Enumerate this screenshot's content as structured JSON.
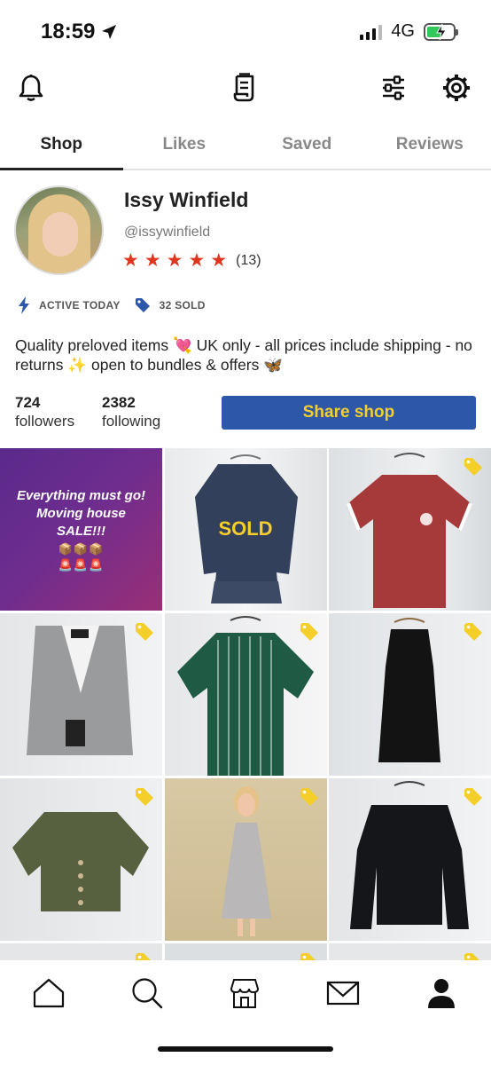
{
  "status_bar": {
    "time": "18:59",
    "network": "4G"
  },
  "tabs": [
    {
      "label": "Shop",
      "active": true
    },
    {
      "label": "Likes",
      "active": false
    },
    {
      "label": "Saved",
      "active": false
    },
    {
      "label": "Reviews",
      "active": false
    }
  ],
  "profile": {
    "name": "Issy Winfield",
    "handle": "@issywinfield",
    "rating_stars": 5,
    "rating_count": "(13)",
    "badges": [
      {
        "icon": "lightning-icon",
        "label": "ACTIVE TODAY"
      },
      {
        "icon": "price-tag-icon",
        "label": "32 SOLD"
      }
    ],
    "bio": "Quality preloved items 💘 UK only - all prices include shipping - no returns ✨ open to bundles & offers 🦋",
    "followers_count": "724",
    "followers_label": "followers",
    "following_count": "2382",
    "following_label": "following",
    "share_button": "Share shop"
  },
  "grid": {
    "promo_text": "Everything must go!\nMoving house\nSALE!!!",
    "promo_emoji_1": "📦📦📦",
    "promo_emoji_2": "🚨🚨🚨",
    "sold_label": "SOLD"
  },
  "colors": {
    "accent_blue": "#2d57a8",
    "accent_yellow": "#f4cf2a",
    "star_red": "#e0351e",
    "lightning_blue": "#2d57a8"
  },
  "bottom_nav": [
    "home-icon",
    "search-icon",
    "shop-icon",
    "mail-icon",
    "profile-icon"
  ]
}
